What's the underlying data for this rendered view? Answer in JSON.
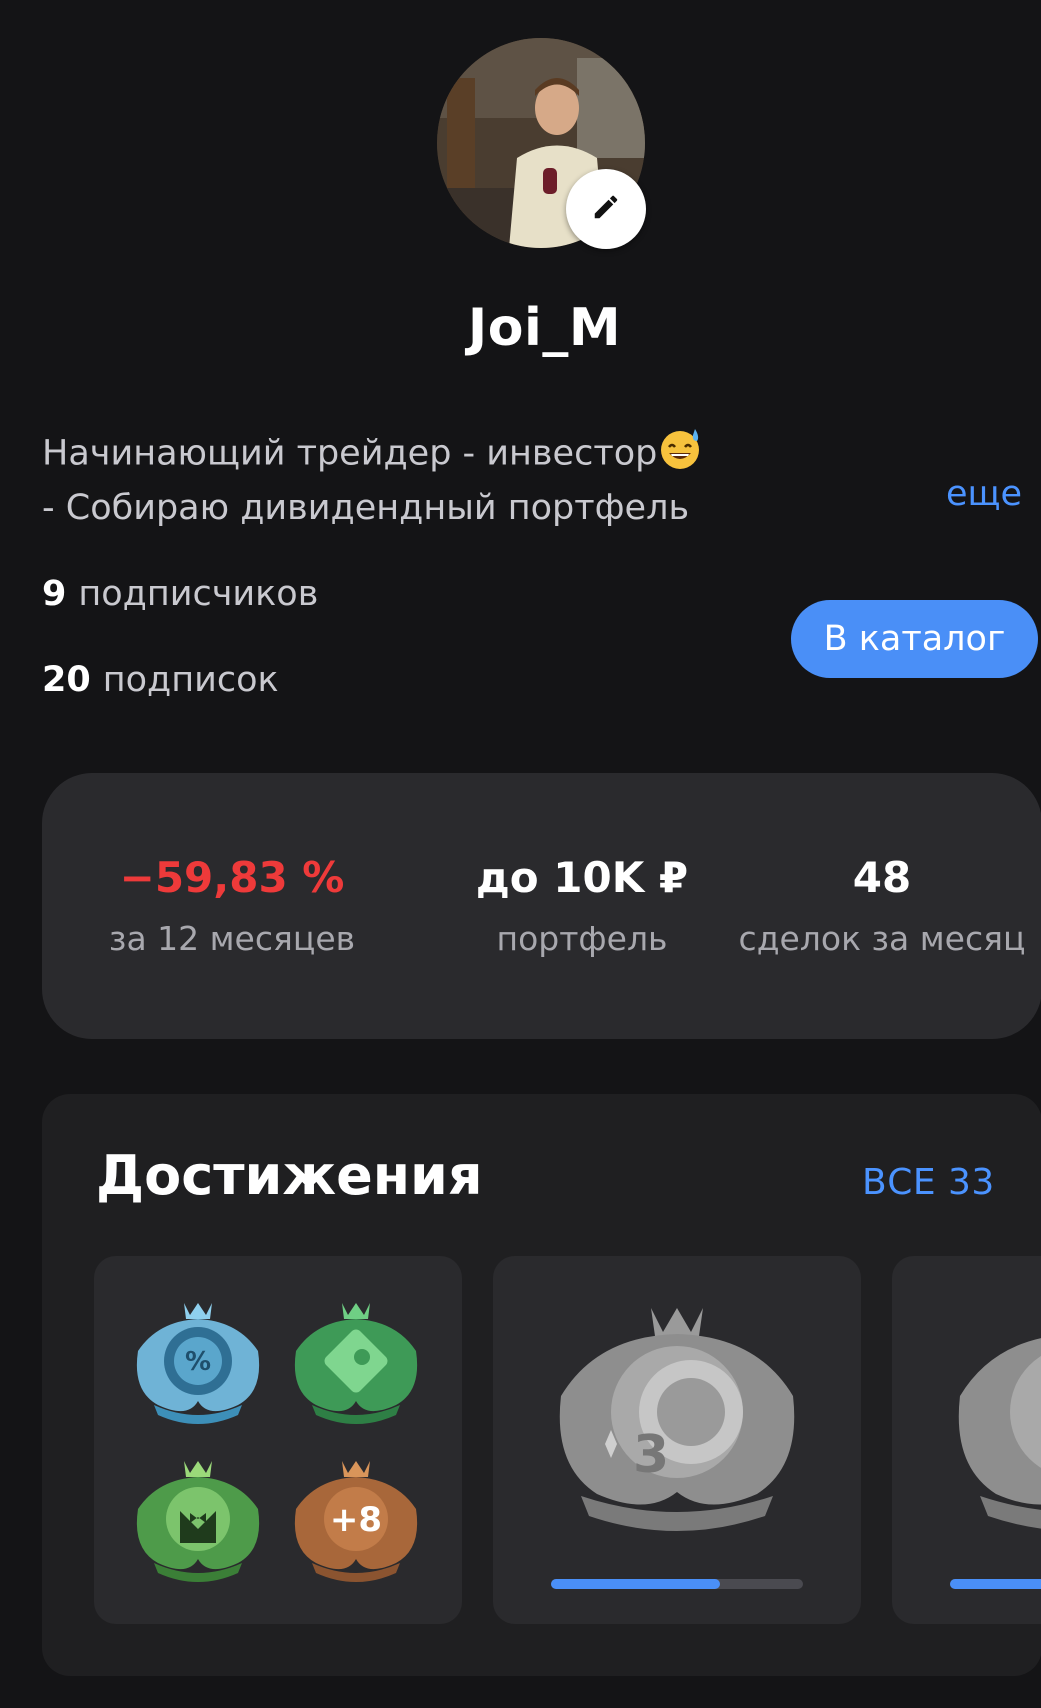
{
  "profile": {
    "username": "Joi_M",
    "bio_line1": "Начинающий трейдер - инвестор",
    "bio_emoji": "sweat-smile-emoji",
    "bio_line2": "- Собираю дивидендный портфель",
    "more_label": "еще",
    "subscribers_count": "9",
    "subscribers_label": "подписчиков",
    "subscriptions_count": "20",
    "subscriptions_label": "подписок",
    "catalog_button": "В каталог",
    "avatar": "user-photo",
    "edit_icon": "pencil-icon"
  },
  "stats": {
    "return_value": "−59,83 %",
    "return_label": "за 12 месяцев",
    "portfolio_value": "до 10K ₽",
    "portfolio_label": "портфель",
    "deals_value": "48",
    "deals_label": "сделок за месяц"
  },
  "achievements": {
    "title": "Достижения",
    "all_label": "ВСЕ 33",
    "tile1_badges": [
      "percent-badge-icon",
      "puzzle-badge-icon",
      "tuxedo-badge-icon"
    ],
    "tile1_more": "+8",
    "tile2_badge": "coin-badge-icon",
    "tile2_progress": 0.67,
    "tile3_badge": "locked-badge-icon",
    "tile3_progress": 1.0
  },
  "colors": {
    "background": "#141416",
    "card": "#2a2a2d",
    "accent": "#4a8ff7",
    "negative": "#ee3a3a",
    "muted_text": "#a8a8ae"
  }
}
